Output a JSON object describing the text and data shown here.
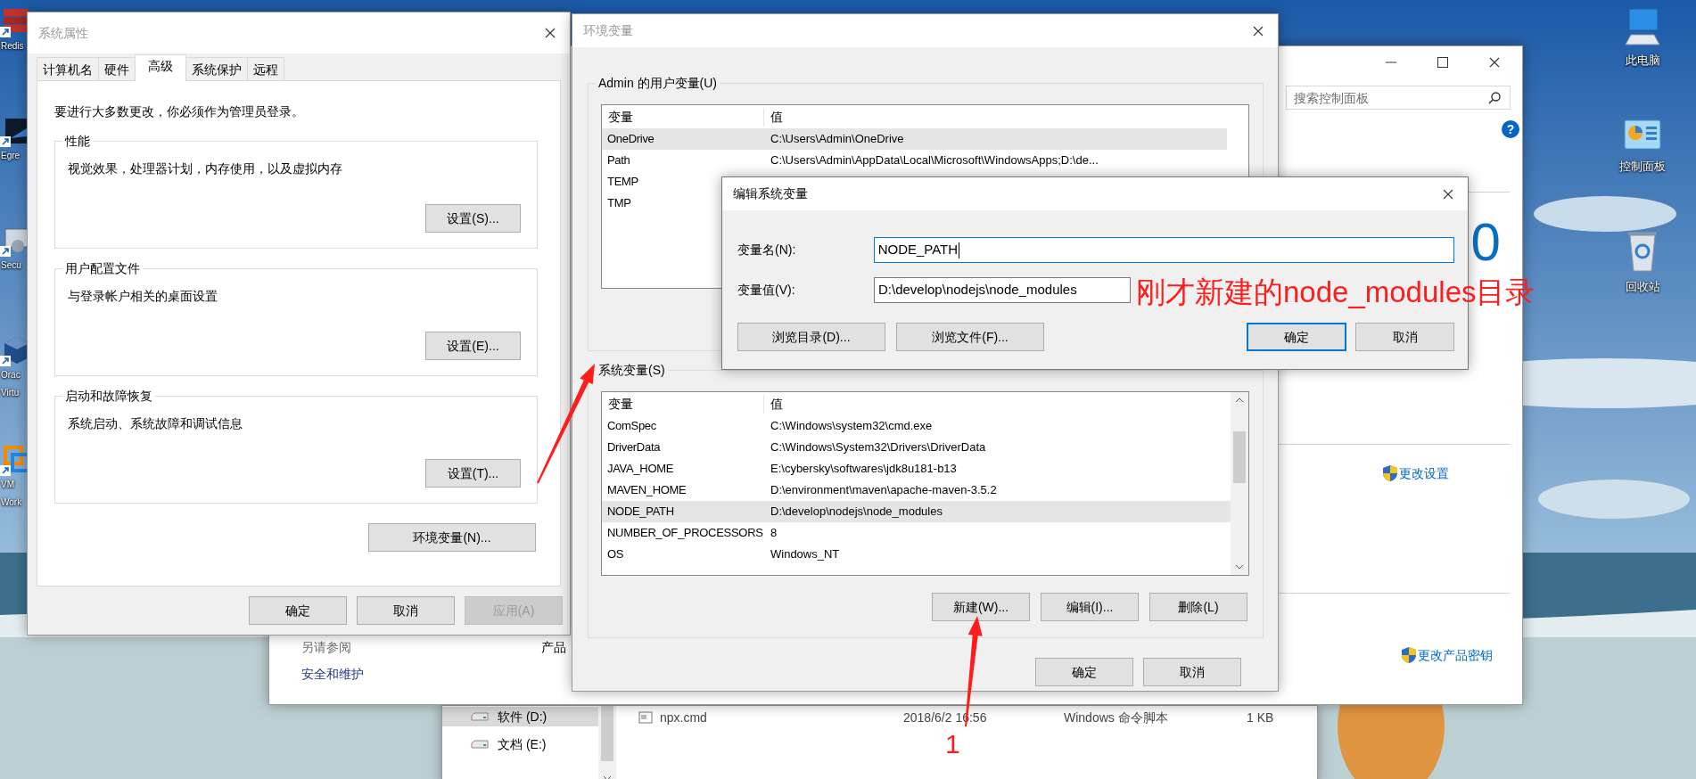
{
  "desktop": {
    "left_icons": [
      {
        "kind": "redis",
        "lines": [
          "Redis"
        ]
      },
      {
        "kind": "egret",
        "lines": [
          "Egre"
        ]
      },
      {
        "kind": "security",
        "lines": [
          "Secu"
        ]
      },
      {
        "kind": "virtualbox",
        "lines": [
          "Orac",
          "Virtu"
        ]
      },
      {
        "kind": "vmware",
        "lines": [
          "VM",
          "Work"
        ]
      }
    ],
    "right_icons": [
      {
        "kind": "computer",
        "label": "此电脑"
      },
      {
        "kind": "panel",
        "label": "控制面板"
      },
      {
        "kind": "bin",
        "label": "回收站"
      }
    ]
  },
  "explorer": {
    "nav": [
      {
        "label": "软件 (D:)",
        "selected": true
      },
      {
        "label": "文档 (E:)",
        "selected": false
      }
    ],
    "file": {
      "name": "npx.cmd",
      "date": "2018/6/2 16:56",
      "type": "Windows 命令脚本",
      "size": "1 KB"
    }
  },
  "control_panel": {
    "search": {
      "placeholder": "搜索控制面板"
    },
    "help": "?",
    "heading": "0",
    "links": [
      "更改设置",
      "更改产品密钥"
    ],
    "see_also": {
      "title": "另请参阅",
      "items": [
        "安全和维护"
      ]
    },
    "section_label": "产品"
  },
  "system_properties": {
    "title": "系统属性",
    "tabs": [
      {
        "label": "计算机名",
        "selected": false
      },
      {
        "label": "硬件",
        "selected": false
      },
      {
        "label": "高级",
        "selected": true
      },
      {
        "label": "系统保护",
        "selected": false
      },
      {
        "label": "远程",
        "selected": false
      }
    ],
    "notice": "要进行大多数更改，你必须作为管理员登录。",
    "groups": [
      {
        "title": "性能",
        "description": "视觉效果，处理器计划，内存使用，以及虚拟内存",
        "button": "设置(S)..."
      },
      {
        "title": "用户配置文件",
        "description": "与登录帐户相关的桌面设置",
        "button": "设置(E)..."
      },
      {
        "title": "启动和故障恢复",
        "description": "系统启动、系统故障和调试信息",
        "button": "设置(T)..."
      }
    ],
    "env_button": "环境变量(N)...",
    "buttons": [
      {
        "label": "确定",
        "disabled": false
      },
      {
        "label": "取消",
        "disabled": false
      },
      {
        "label": "应用(A)",
        "disabled": true
      }
    ]
  },
  "environment_variables": {
    "title": "环境变量",
    "user_section": {
      "title": "Admin 的用户变量(U)",
      "columns": [
        "变量",
        "值"
      ],
      "rows": [
        {
          "name": "OneDrive",
          "value": "C:\\Users\\Admin\\OneDrive",
          "selected": true
        },
        {
          "name": "Path",
          "value": "C:\\Users\\Admin\\AppData\\Local\\Microsoft\\WindowsApps;D:\\de...",
          "selected": false
        },
        {
          "name": "TEMP",
          "selected": false
        },
        {
          "name": "TMP",
          "selected": false
        }
      ]
    },
    "system_section": {
      "title": "系统变量(S)",
      "columns": [
        "变量",
        "值"
      ],
      "rows": [
        {
          "name": "ComSpec",
          "value": "C:\\Windows\\system32\\cmd.exe",
          "selected": false
        },
        {
          "name": "DriverData",
          "value": "C:\\Windows\\System32\\Drivers\\DriverData",
          "selected": false
        },
        {
          "name": "JAVA_HOME",
          "value": "E:\\cybersky\\softwares\\jdk8u181-b13",
          "selected": false
        },
        {
          "name": "MAVEN_HOME",
          "value": "D:\\environment\\maven\\apache-maven-3.5.2",
          "selected": false
        },
        {
          "name": "NODE_PATH",
          "value": "D:\\develop\\nodejs\\node_modules",
          "selected": true
        },
        {
          "name": "NUMBER_OF_PROCESSORS",
          "value": "8",
          "selected": false
        },
        {
          "name": "OS",
          "value": "Windows_NT",
          "selected": false
        }
      ],
      "buttons": [
        "新建(W)...",
        "编辑(I)...",
        "删除(L)"
      ]
    },
    "buttons": [
      "确定",
      "取消"
    ]
  },
  "edit_dialog": {
    "title": "编辑系统变量",
    "fields": [
      {
        "label": "变量名(N):",
        "value": "NODE_PATH",
        "focused": true
      },
      {
        "label": "变量值(V):",
        "value": "D:\\develop\\nodejs\\node_modules",
        "focused": false
      }
    ],
    "browse_buttons": [
      "浏览目录(D)...",
      "浏览文件(F)..."
    ],
    "buttons": [
      {
        "label": "确定",
        "default": true
      },
      {
        "label": "取消",
        "default": false
      }
    ]
  },
  "annotations": [
    {
      "kind": "arrow"
    },
    {
      "kind": "arrow"
    },
    {
      "kind": "label",
      "text": "刚才新建的node_modules目录"
    },
    {
      "kind": "label",
      "text": "1"
    }
  ]
}
